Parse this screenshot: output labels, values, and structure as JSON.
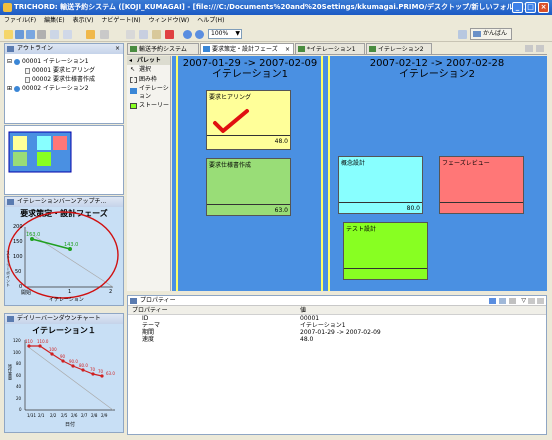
{
  "window": {
    "title": "TRICHORD: 輸送予約システム ([KOJI_KUMAGAI] - [file:///C:/Documents%20and%20Settings/kkumagai.PRIMO/デスクトップ/新しいフォルダ])"
  },
  "menu": [
    "ファイル(F)",
    "編集(E)",
    "表示(V)",
    "ナビゲート(N)",
    "ウィンドウ(W)",
    "ヘルプ(H)"
  ],
  "toolbar": {
    "zoom": "100%",
    "kanban_label": "かんばん"
  },
  "outline": {
    "title": "アウトライン",
    "items": [
      {
        "label": "00001 イテレーション1",
        "level": 0
      },
      {
        "label": "00001 要求ヒアリング",
        "level": 1
      },
      {
        "label": "00002 要求仕様書作成",
        "level": 1
      },
      {
        "label": "00002 イテレーション2",
        "level": 0
      }
    ]
  },
  "burnup": {
    "title": "イテレーションバーンアップチ...",
    "chart_title": "要求策定・設計フェーズ",
    "xlabel": "イテレーション",
    "ylabel": "ストーリーポイント",
    "yticks": [
      "200",
      "150",
      "100",
      "50",
      "0"
    ],
    "xticks": [
      "開始",
      "1",
      "2"
    ],
    "point_labels": [
      "163.0",
      "143.0"
    ]
  },
  "burndown": {
    "title": "デイリーバーンダウンチャート",
    "chart_title": "イテレーション１",
    "xlabel": "日付",
    "ylabel": "残作業量",
    "yticks": [
      "120",
      "100",
      "80",
      "60",
      "40",
      "20",
      "0"
    ],
    "xticks": [
      "1/31",
      "2/1",
      "2/2",
      "2/5",
      "2/6",
      "2/7",
      "2/8",
      "2/9"
    ],
    "point_labels": [
      "110",
      "110.0",
      "100",
      "90",
      "90.0",
      "80.0",
      "70",
      "70",
      "63.0"
    ]
  },
  "tabs": [
    {
      "label": "輸送予約システム",
      "active": false
    },
    {
      "label": "要求策定・設計フェーズ",
      "active": true
    },
    {
      "label": "*イテレーション1",
      "active": false
    },
    {
      "label": "イテレーション2",
      "active": false
    }
  ],
  "palette": {
    "title": "パレット",
    "items": [
      "選択",
      "囲み枠",
      "イテレーション",
      "ストーリー"
    ]
  },
  "board": {
    "iterations": [
      {
        "dates": "2007-01-29 -> 2007-02-09",
        "name": "イテレーション1"
      },
      {
        "dates": "2007-02-12 -> 2007-02-28",
        "name": "イテレーション2"
      }
    ],
    "cards": [
      {
        "label": "要求ヒアリング",
        "value": "48.0",
        "color": "#ffff99",
        "done": true
      },
      {
        "label": "要求仕様書作成",
        "value": "63.0",
        "color": "#99dd77",
        "done": false
      },
      {
        "label": "概念設計",
        "value": "80.0",
        "color": "#88ffff",
        "done": false
      },
      {
        "label": "フェーズレビュー",
        "value": "",
        "color": "#ff7777",
        "done": false
      },
      {
        "label": "テスト設計",
        "value": "",
        "color": "#88ff22",
        "done": false
      }
    ]
  },
  "properties": {
    "title": "プロパティー",
    "columns": [
      "プロパティー",
      "値"
    ],
    "rows": [
      {
        "key": "ID",
        "value": "00001"
      },
      {
        "key": "テーマ",
        "value": "イテレーション1"
      },
      {
        "key": "期間",
        "value": "2007-01-29 -> 2007-02-09"
      },
      {
        "key": "速度",
        "value": "48.0"
      }
    ]
  }
}
